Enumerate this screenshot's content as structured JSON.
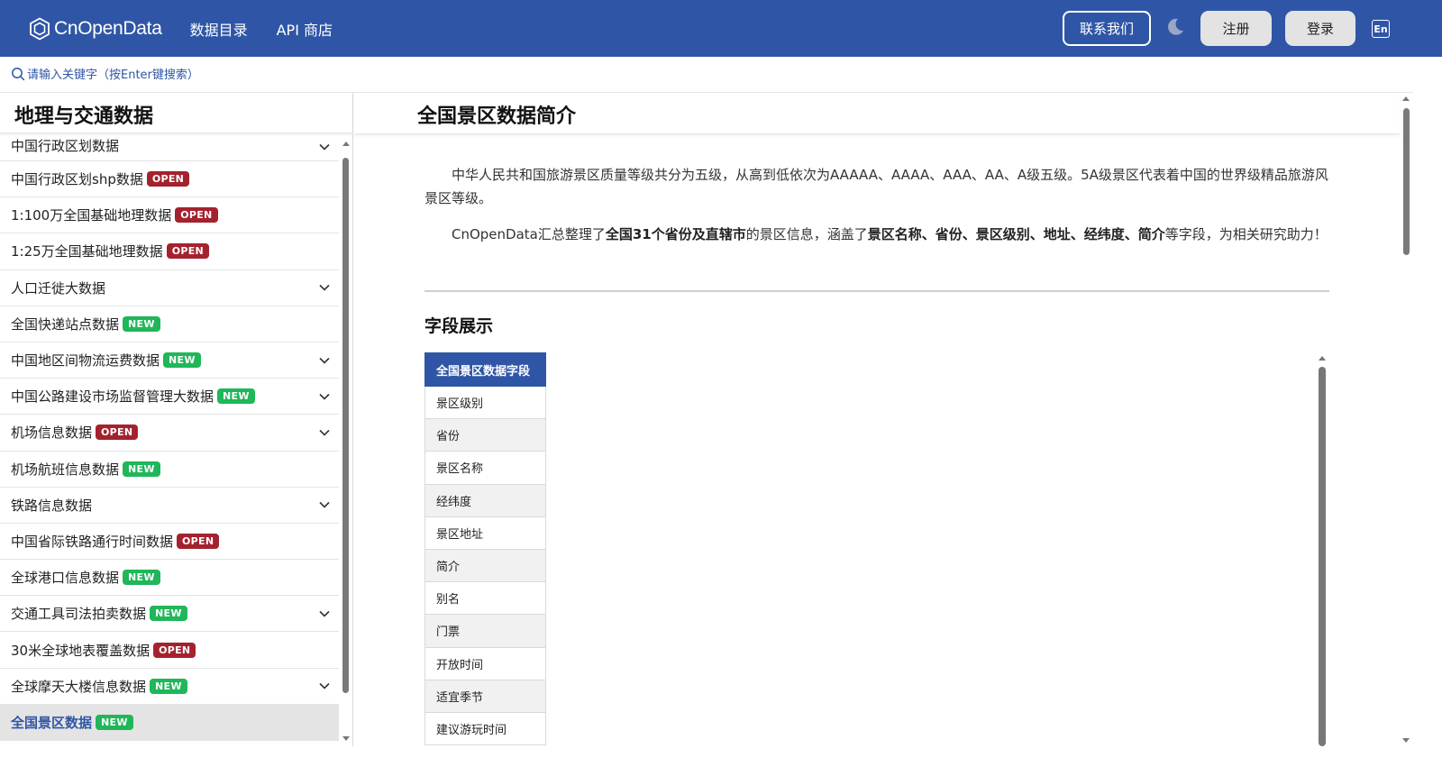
{
  "header": {
    "logo_text": "CnOpenData",
    "nav": [
      "数据目录",
      "API 商店"
    ],
    "contact_label": "联系我们",
    "register_label": "注册",
    "login_label": "登录",
    "lang_label": "En",
    "brand_color": "#2f56a6"
  },
  "search": {
    "placeholder": "请输入关键字（按Enter键搜索）"
  },
  "sidebar": {
    "title": "地理与交通数据",
    "items": [
      {
        "label": "中国行政区划数据",
        "badge": "",
        "expandable": true
      },
      {
        "label": "中国行政区划shp数据",
        "badge": "OPEN",
        "expandable": false
      },
      {
        "label": "1:100万全国基础地理数据",
        "badge": "OPEN",
        "expandable": false
      },
      {
        "label": "1:25万全国基础地理数据",
        "badge": "OPEN",
        "expandable": false
      },
      {
        "label": "人口迁徙大数据",
        "badge": "",
        "expandable": true
      },
      {
        "label": "全国快递站点数据",
        "badge": "NEW",
        "expandable": false
      },
      {
        "label": "中国地区间物流运费数据",
        "badge": "NEW",
        "expandable": true
      },
      {
        "label": "中国公路建设市场监督管理大数据",
        "badge": "NEW",
        "expandable": true
      },
      {
        "label": "机场信息数据",
        "badge": "OPEN",
        "expandable": true
      },
      {
        "label": "机场航班信息数据",
        "badge": "NEW",
        "expandable": false
      },
      {
        "label": "铁路信息数据",
        "badge": "",
        "expandable": true
      },
      {
        "label": "中国省际铁路通行时间数据",
        "badge": "OPEN",
        "expandable": false
      },
      {
        "label": "全球港口信息数据",
        "badge": "NEW",
        "expandable": false
      },
      {
        "label": "交通工具司法拍卖数据",
        "badge": "NEW",
        "expandable": true
      },
      {
        "label": "30米全球地表覆盖数据",
        "badge": "OPEN",
        "expandable": false
      },
      {
        "label": "全球摩天大楼信息数据",
        "badge": "NEW",
        "expandable": true
      },
      {
        "label": "全国景区数据",
        "badge": "NEW",
        "expandable": false,
        "active": true
      }
    ]
  },
  "main": {
    "title": "全国景区数据简介",
    "intro_p1": "中华人民共和国旅游景区质量等级共分为五级，从高到低依次为AAAAA、AAAA、AAA、AA、A级五级。5A级景区代表着中国的世界级精品旅游风景区等级。",
    "intro_p2_a": "CnOpenData汇总整理了",
    "intro_p2_b": "全国31个省份及直辖市",
    "intro_p2_c": "的景区信息，涵盖了",
    "intro_p2_d": "景区名称、省份、景区级别、地址、经纬度、简介",
    "intro_p2_e": "等字段，为相关研究助力！",
    "section_title": "字段展示",
    "table_header": "全国景区数据字段",
    "fields": [
      "景区级别",
      "省份",
      "景区名称",
      "经纬度",
      "景区地址",
      "简介",
      "别名",
      "门票",
      "开放时间",
      "适宜季节",
      "建议游玩时间"
    ]
  }
}
